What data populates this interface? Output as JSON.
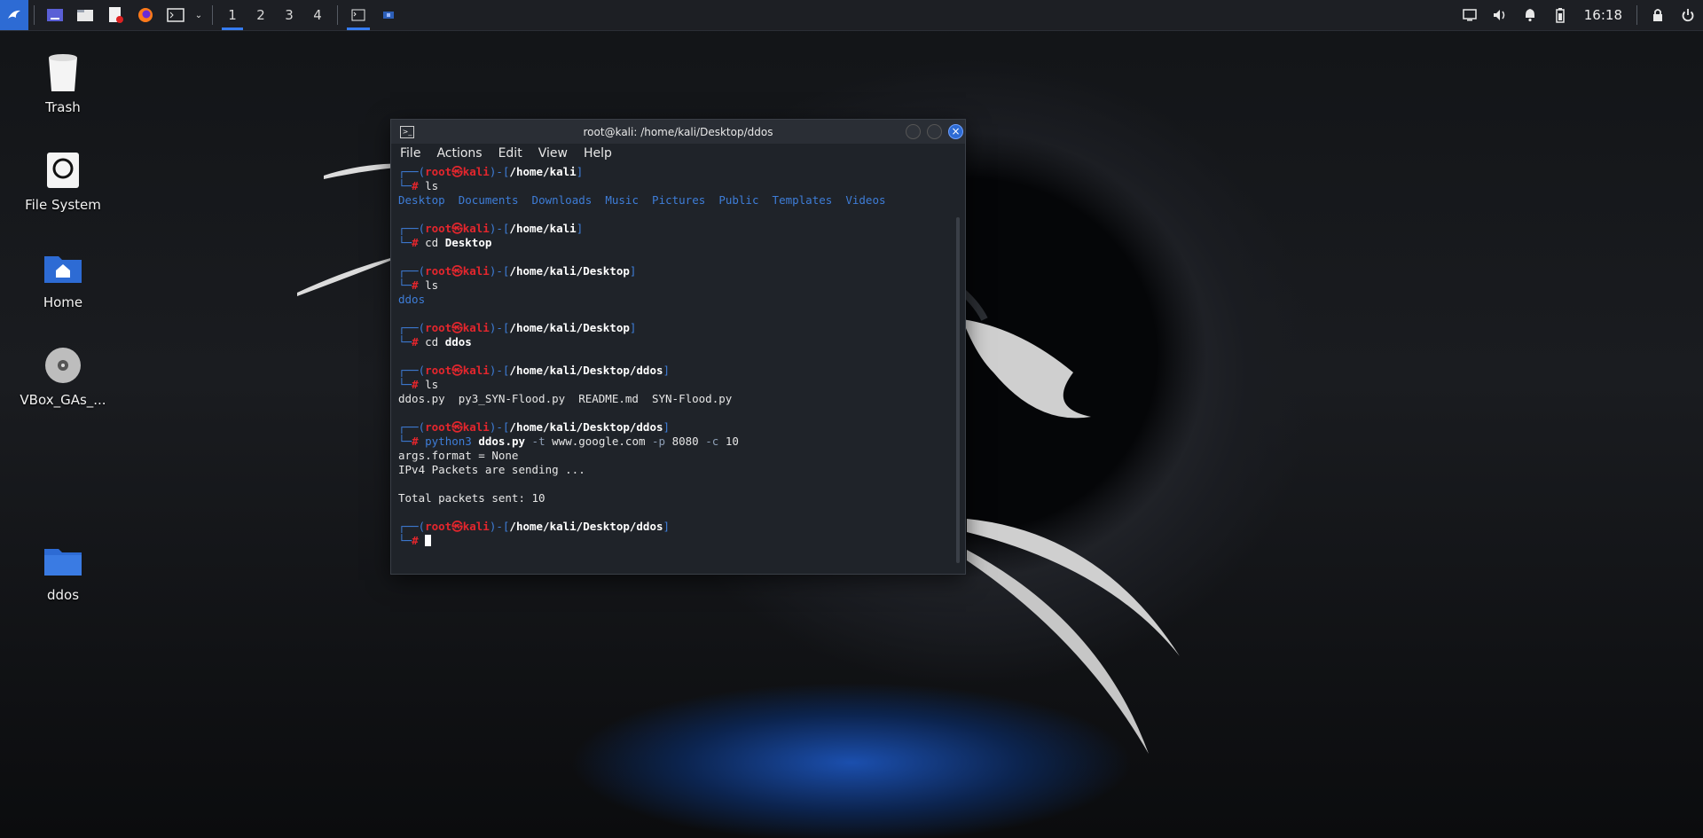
{
  "panel": {
    "workspaces": [
      "1",
      "2",
      "3",
      "4"
    ],
    "clock": "16:18",
    "accent": "#367bf0"
  },
  "desktop": {
    "icons": [
      {
        "label": "Trash",
        "icon": "trash-icon"
      },
      {
        "label": "File System",
        "icon": "drive-icon"
      },
      {
        "label": "Home",
        "icon": "home-folder-icon"
      },
      {
        "label": "VBox_GAs_...",
        "icon": "cd-icon"
      },
      {
        "label": "ddos",
        "icon": "folder-icon"
      }
    ]
  },
  "terminal": {
    "title": "root@kali: /home/kali/Desktop/ddos",
    "menu": [
      "File",
      "Actions",
      "Edit",
      "View",
      "Help"
    ],
    "prompt": {
      "open": "┌──(",
      "user": "root",
      "at": "㉿",
      "host": "kali",
      "mid": ")-[",
      "close": "]",
      "hash_prefix": "└─",
      "hash": "#"
    },
    "blocks": [
      {
        "path": "/home/kali",
        "cmd": "ls",
        "cmd_parts": [
          {
            "t": "ls",
            "c": "plain"
          }
        ],
        "output": [
          [
            {
              "t": "Desktop",
              "c": "blu"
            },
            {
              "t": "  "
            },
            {
              "t": "Documents",
              "c": "blu"
            },
            {
              "t": "  "
            },
            {
              "t": "Downloads",
              "c": "blu"
            },
            {
              "t": "  "
            },
            {
              "t": "Music",
              "c": "blu"
            },
            {
              "t": "  "
            },
            {
              "t": "Pictures",
              "c": "blu"
            },
            {
              "t": "  "
            },
            {
              "t": "Public",
              "c": "blu"
            },
            {
              "t": "  "
            },
            {
              "t": "Templates",
              "c": "blu"
            },
            {
              "t": "  "
            },
            {
              "t": "Videos",
              "c": "blu"
            }
          ]
        ]
      },
      {
        "path": "/home/kali",
        "cmd_parts": [
          {
            "t": "cd ",
            "c": "plain"
          },
          {
            "t": "Desktop",
            "c": "bold"
          }
        ],
        "output": []
      },
      {
        "path": "/home/kali/Desktop",
        "cmd_parts": [
          {
            "t": "ls",
            "c": "plain"
          }
        ],
        "output": [
          [
            {
              "t": "ddos",
              "c": "blu"
            }
          ]
        ]
      },
      {
        "path": "/home/kali/Desktop",
        "cmd_parts": [
          {
            "t": "cd ",
            "c": "plain"
          },
          {
            "t": "ddos",
            "c": "bold"
          }
        ],
        "output": []
      },
      {
        "path": "/home/kali/Desktop/ddos",
        "cmd_parts": [
          {
            "t": "ls",
            "c": "plain"
          }
        ],
        "output": [
          [
            {
              "t": "ddos.py  py3_SYN-Flood.py  README.md  SYN-Flood.py"
            }
          ]
        ]
      },
      {
        "path": "/home/kali/Desktop/ddos",
        "cmd_parts": [
          {
            "t": "python3 ",
            "c": "blu"
          },
          {
            "t": "ddos.py",
            "c": "bold"
          },
          {
            "t": " -t ",
            "c": "opt"
          },
          {
            "t": "www.google.com"
          },
          {
            "t": " -p ",
            "c": "opt"
          },
          {
            "t": "8080"
          },
          {
            "t": " -c ",
            "c": "opt"
          },
          {
            "t": "10"
          }
        ],
        "output": [
          [
            {
              "t": "args.format = None"
            }
          ],
          [
            {
              "t": "IPv4 Packets are sending ..."
            }
          ],
          [
            {
              "t": ""
            }
          ],
          [
            {
              "t": "Total packets sent: 10"
            }
          ]
        ]
      }
    ],
    "final_prompt_path": "/home/kali/Desktop/ddos"
  }
}
